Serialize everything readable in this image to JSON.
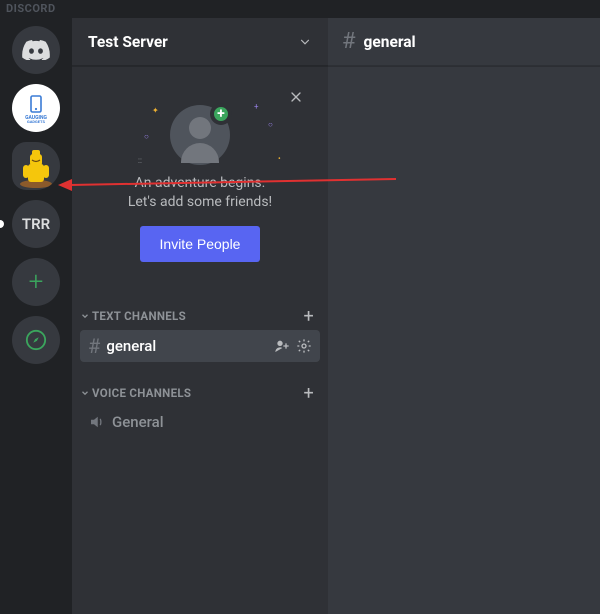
{
  "app_label": "DISCORD",
  "servers": {
    "gauging_label": "GAUGING GADGETS",
    "trr_label": "TRR"
  },
  "server_header": {
    "name": "Test Server"
  },
  "welcome": {
    "line1": "An adventure begins.",
    "line2": "Let's add some friends!",
    "invite_label": "Invite People"
  },
  "categories": {
    "text_label": "TEXT CHANNELS",
    "voice_label": "VOICE CHANNELS"
  },
  "channels": {
    "text_general": "general",
    "voice_general": "General"
  },
  "chat": {
    "title": "general"
  }
}
